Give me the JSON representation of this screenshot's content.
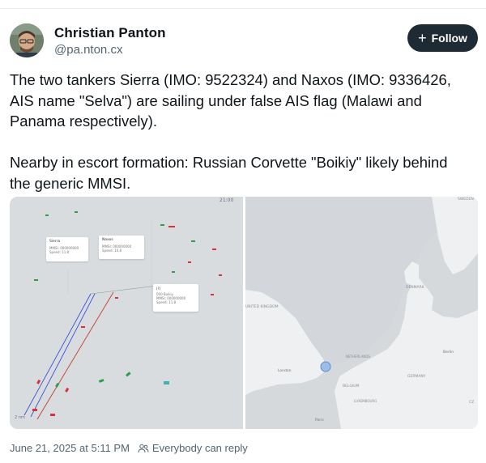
{
  "author": {
    "name": "Christian Panton",
    "handle": "@pa.nton.cx",
    "follow_label": "Follow"
  },
  "post": {
    "text": "The two tankers Sierra (IMO: 9522324) and Naxos (IMO: 9336426, AIS name \"Selva\") are sailing under false AIS flag (Malawi and Panama respectively).\n\nNearby in escort formation: Russian Corvette \"Boikiy\" likely behind the generic MMSI."
  },
  "media": {
    "ais_panel": {
      "clock": "21:00",
      "scale": "2 nm",
      "popups": [
        {
          "title": "Sierra",
          "line1": "MMSI: 000000000",
          "line2": "Speed: 11.8"
        },
        {
          "title": "Naxos",
          "line1": "MMSI: 000000000",
          "line2": "Speed: 10.8"
        },
        {
          "title": "(?)",
          "line1": "000 Boikiy",
          "line2": "MMSI: 000000000",
          "line3": "Speed: 11.8"
        }
      ]
    },
    "map_panel": {
      "labels": {
        "sweden": "SWEDEN",
        "united_kingdom": "UNITED KINGDOM",
        "denmark": "DENMARK",
        "london": "London",
        "netherlands": "NETHERLANDS",
        "berlin": "Berlin",
        "germany": "GERMANY",
        "belgium": "BELGIUM",
        "luxembourg": "LUXEMBOURG",
        "paris": "Paris",
        "cz": "CZ"
      },
      "marker_color": "#9bbde8"
    }
  },
  "footer": {
    "date": "June 21, 2025 at 5:11 PM",
    "reply_setting": "Everybody can reply"
  },
  "colors": {
    "follow_bg": "#1e2b35",
    "route_blue": "#3b4fd6",
    "route_red": "#c0392b"
  }
}
